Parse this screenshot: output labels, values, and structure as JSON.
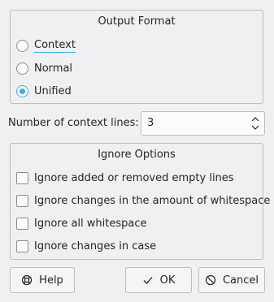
{
  "output_format": {
    "title": "Output Format",
    "options": [
      {
        "label": "Context",
        "checked": false,
        "focused": true
      },
      {
        "label": "Normal",
        "checked": false,
        "focused": false
      },
      {
        "label": "Unified",
        "checked": true,
        "focused": false
      }
    ]
  },
  "context_lines": {
    "label": "Number of context lines:",
    "value": "3"
  },
  "ignore_options": {
    "title": "Ignore Options",
    "options": [
      {
        "label": "Ignore added or removed empty lines",
        "checked": false
      },
      {
        "label": "Ignore changes in the amount of whitespace",
        "checked": false
      },
      {
        "label": "Ignore all whitespace",
        "checked": false
      },
      {
        "label": "Ignore changes in case",
        "checked": false
      }
    ]
  },
  "buttons": {
    "help": {
      "label": "Help",
      "icon": "lifebuoy-icon"
    },
    "ok": {
      "label": "OK",
      "icon": "checkmark-icon"
    },
    "cancel": {
      "label": "Cancel",
      "icon": "cancel-icon"
    }
  },
  "colors": {
    "accent": "#3daee9",
    "background": "#eff0f1",
    "text": "#232627"
  }
}
